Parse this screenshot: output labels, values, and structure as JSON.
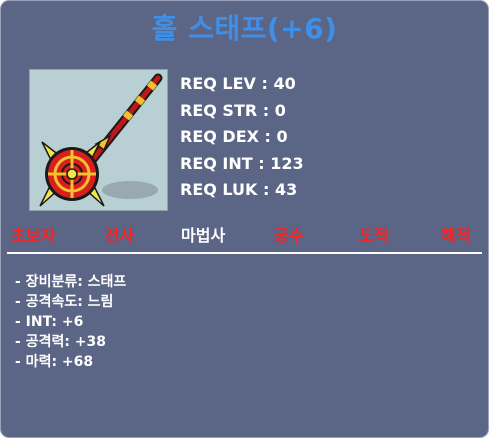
{
  "item": {
    "name": "홀 스태프(+6)",
    "icon": "red-gold-staff-icon"
  },
  "requirements": [
    "REQ LEV : 40",
    "REQ STR : 0",
    "REQ DEX : 0",
    "REQ INT : 123",
    "REQ LUK : 43"
  ],
  "jobs": [
    {
      "label": "초보자",
      "allowed": false
    },
    {
      "label": "전사",
      "allowed": false
    },
    {
      "label": "마법사",
      "allowed": true
    },
    {
      "label": "궁수",
      "allowed": false
    },
    {
      "label": "도적",
      "allowed": false
    },
    {
      "label": "해적",
      "allowed": false
    }
  ],
  "stats": [
    "- 장비분류: 스태프",
    "- 공격속도: 느림",
    "- INT: +6",
    "- 공격력: +38",
    "- 마력: +68"
  ],
  "colors": {
    "panel": "#5b6585",
    "title": "#3f8fe8",
    "job_disallowed": "#ff1f1f",
    "job_allowed": "#ffffff"
  }
}
